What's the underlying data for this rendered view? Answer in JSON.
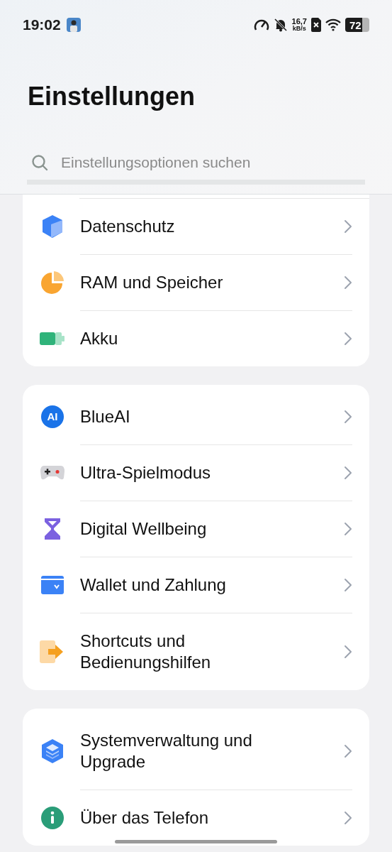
{
  "status_bar": {
    "time": "19:02",
    "net_speed_value": "16,7",
    "net_speed_unit": "kB/s",
    "battery": "72"
  },
  "header": {
    "title": "Einstellungen"
  },
  "search": {
    "placeholder": "Einstellungsoptionen suchen"
  },
  "groups": [
    {
      "cut_top": true,
      "items": [
        {
          "kind": "cube",
          "label": "Datenschutz"
        },
        {
          "kind": "pie",
          "label": "RAM und Speicher"
        },
        {
          "kind": "battery",
          "label": "Akku"
        }
      ]
    },
    {
      "cut_top": false,
      "items": [
        {
          "kind": "ai",
          "label": "BlueAI",
          "badge": "AI"
        },
        {
          "kind": "gamepad",
          "label": "Ultra-Spielmodus"
        },
        {
          "kind": "hourglass",
          "label": "Digital Wellbeing"
        },
        {
          "kind": "wallet",
          "label": "Wallet und Zahlung"
        },
        {
          "kind": "shortcut",
          "label": "Shortcuts und Bedienungshilfen"
        }
      ]
    },
    {
      "cut_top": false,
      "items": [
        {
          "kind": "layers",
          "label": "Systemverwaltung und Upgrade"
        },
        {
          "kind": "info",
          "label": "Über das Telefon"
        }
      ]
    }
  ]
}
